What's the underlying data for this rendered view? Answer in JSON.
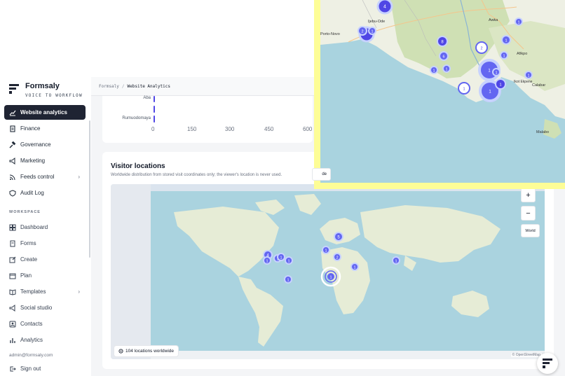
{
  "brand": {
    "name": "Formsaly",
    "tagline": "VOICE TO WORKFLOW"
  },
  "nav": {
    "items": [
      {
        "label": "Website analytics",
        "icon": "chart-line-icon",
        "active": true
      },
      {
        "label": "Finance",
        "icon": "receipt-icon"
      },
      {
        "label": "Governance",
        "icon": "gavel-icon"
      },
      {
        "label": "Marketing",
        "icon": "megaphone-icon"
      },
      {
        "label": "Feeds control",
        "icon": "rss-icon",
        "chevron": "›"
      },
      {
        "label": "Audit Log",
        "icon": "shield-icon"
      }
    ],
    "workspace_label": "WORKSPACE",
    "workspace_items": [
      {
        "label": "Dashboard",
        "icon": "grid-icon"
      },
      {
        "label": "Forms",
        "icon": "document-icon"
      },
      {
        "label": "Create",
        "icon": "edit-icon"
      },
      {
        "label": "Plan",
        "icon": "calendar-icon"
      },
      {
        "label": "Templates",
        "icon": "book-icon",
        "chevron": "›"
      },
      {
        "label": "Social studio",
        "icon": "megaphone-icon"
      },
      {
        "label": "Contacts",
        "icon": "contacts-icon"
      },
      {
        "label": "Analytics",
        "icon": "bar-chart-icon"
      }
    ],
    "user_email": "admin@formsaly.com",
    "sign_out": "Sign out"
  },
  "breadcrumb": {
    "root": "Formsaly",
    "separator": "/",
    "current": "Website Analytics"
  },
  "top_chart": {
    "bar_labels": [
      "Aba",
      "",
      "Rumuodomaya"
    ],
    "bar_values": [
      6,
      4,
      3
    ],
    "axis_max": 600,
    "ticks": [
      "0",
      "150",
      "300",
      "450",
      "600"
    ]
  },
  "visitor_locations": {
    "title": "Visitor locations",
    "description": "Worldwide distribution from stored visit coordinates only; the viewer's location is never used.",
    "zoom_in": "+",
    "zoom_out": "−",
    "world_button": "World",
    "locations_count": "104 locations worldwide",
    "attribution": "© OpenStreetMap",
    "clusters": [
      "4",
      "1",
      "1",
      "1",
      "1",
      "1",
      "5",
      "1",
      "2",
      "1",
      "1",
      "1"
    ]
  },
  "popout_map": {
    "labels": [
      "Porto-Novo",
      "Ijebu-Ode",
      "Awka",
      "Afikpo",
      "Calabar",
      "Ikot Ekpene",
      "Malabo"
    ],
    "clusters": [
      "4",
      "2",
      "1",
      "6",
      "8",
      "2",
      "1",
      "1",
      "1",
      "1",
      "1",
      "1",
      "1",
      "1",
      "1",
      "1",
      "1"
    ],
    "partial_button": "de"
  },
  "colors": {
    "accent": "#4f46e5",
    "nav_active": "#1f2433",
    "highlight": "#fdfd96"
  }
}
